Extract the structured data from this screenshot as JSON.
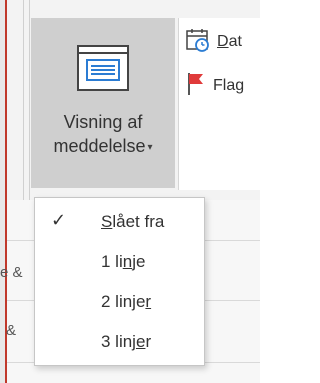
{
  "ribbon": {
    "view_button": {
      "label_line1": "Visning af",
      "label_line2": "meddelelse",
      "caret": "▾"
    },
    "side_group": {
      "date_label_underlined": "D",
      "date_label_rest": "at",
      "flag_label": "Flag"
    }
  },
  "dropdown": {
    "items": [
      {
        "pre": "",
        "u": "S",
        "post": "lået fra",
        "checked": true
      },
      {
        "pre": "1 li",
        "u": "n",
        "post": "je",
        "checked": false
      },
      {
        "pre": "2 linje",
        "u": "r",
        "post": "",
        "checked": false
      },
      {
        "pre": "3 linj",
        "u": "e",
        "post": "r",
        "checked": false
      }
    ],
    "check_glyph": "✓"
  },
  "background_fragments": {
    "row1": "e &",
    "row2": "&"
  },
  "colors": {
    "accent_red": "#c0392b",
    "flag_red": "#e03a3a",
    "icon_blue": "#2b7cd3"
  }
}
